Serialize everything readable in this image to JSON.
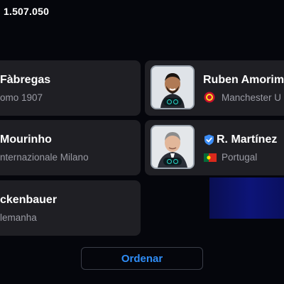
{
  "header": {
    "points": "1.507.050"
  },
  "cards": [
    {
      "name": "Fàbregas",
      "club": "omo 1907"
    },
    {
      "name": "Ruben Amorim",
      "club": "Manchester U"
    },
    {
      "name": "Mourinho",
      "club": "nternazionale Milano"
    },
    {
      "name": "R. Martínez",
      "club": "Portugal"
    },
    {
      "name": "ckenbauer",
      "club": "lemanha"
    }
  ],
  "icons": {
    "verified": "verified-badge-icon",
    "club_crest": "manchester-united-crest-icon",
    "flag": "portugal-flag-icon",
    "chip": "chemistry-chip-icon"
  },
  "colors": {
    "accent": "#2f8df7",
    "chip": "#27d9c8",
    "verified": "#3b8cf5"
  },
  "footer": {
    "sort_label": "Ordenar"
  }
}
